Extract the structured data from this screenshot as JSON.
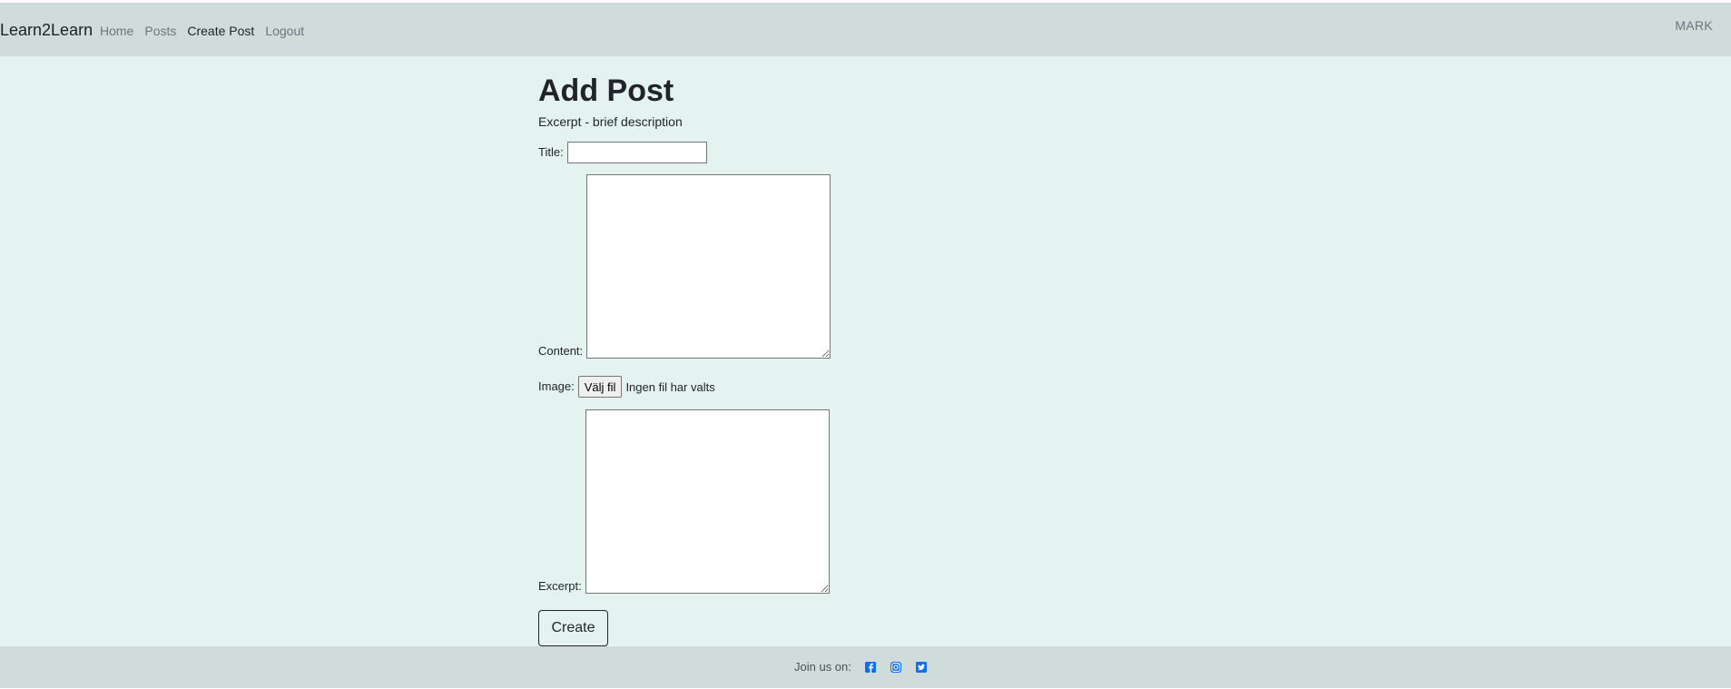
{
  "navbar": {
    "brand": "Learn2Learn",
    "links": [
      {
        "label": "Home",
        "active": false
      },
      {
        "label": "Posts",
        "active": false
      },
      {
        "label": "Create Post",
        "active": true
      },
      {
        "label": "Logout",
        "active": false
      }
    ],
    "user": "MARK"
  },
  "form": {
    "heading": "Add Post",
    "subtitle": "Excerpt - brief description",
    "title_label": "Title:",
    "title_value": "",
    "content_label": "Content:",
    "content_value": "",
    "image_label": "Image:",
    "file_button": "Välj fil",
    "file_status": "Ingen fil har valts",
    "excerpt_label": "Excerpt:",
    "excerpt_value": "",
    "submit_label": "Create"
  },
  "footer": {
    "text": "Join us on:",
    "icons": [
      "facebook-icon",
      "instagram-icon",
      "twitter-icon"
    ],
    "icon_color": "#0d6efd"
  },
  "colors": {
    "navbar_bg": "#cfdcda",
    "main_bg": "#e4f3ef",
    "footer_bg": "#cfdcda"
  }
}
